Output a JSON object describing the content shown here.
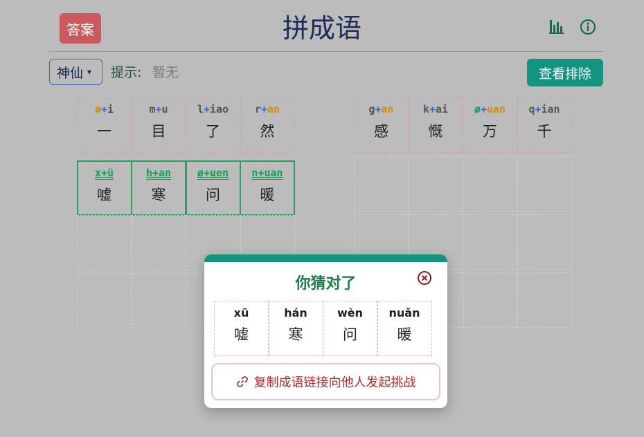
{
  "header": {
    "answer_label": "答案",
    "title": "拼成语"
  },
  "toolbar": {
    "mode": "神仙",
    "hint_label": "提示:",
    "hint_value": "暂无",
    "exclude_label": "查看排除"
  },
  "left_grid": {
    "rows": [
      {
        "state": "guess",
        "cells": [
          {
            "initial": "ø",
            "initial_color": "orange",
            "final": "i",
            "final_color": "plain",
            "char": "一"
          },
          {
            "initial": "m",
            "initial_color": "plain",
            "final": "u",
            "final_color": "plain",
            "char": "目"
          },
          {
            "initial": "l",
            "initial_color": "plain",
            "final": "iao",
            "final_color": "plain",
            "char": "了"
          },
          {
            "initial": "r",
            "initial_color": "plain",
            "final": "an",
            "final_color": "orange",
            "char": "然"
          }
        ]
      },
      {
        "state": "correct",
        "cells": [
          {
            "initial": "x",
            "initial_color": "green",
            "final": "ü",
            "final_color": "green",
            "char": "嘘"
          },
          {
            "initial": "h",
            "initial_color": "green",
            "final": "an",
            "final_color": "green",
            "char": "寒"
          },
          {
            "initial": "ø",
            "initial_color": "green",
            "final": "uen",
            "final_color": "green",
            "char": "问"
          },
          {
            "initial": "n",
            "initial_color": "green",
            "final": "uan",
            "final_color": "green",
            "char": "暖"
          }
        ]
      }
    ],
    "empty_rows": 2
  },
  "right_grid": {
    "rows": [
      {
        "state": "guess",
        "cells": [
          {
            "initial": "g",
            "initial_color": "plain",
            "final": "an",
            "final_color": "orange",
            "char": "感"
          },
          {
            "initial": "k",
            "initial_color": "plain",
            "final": "ai",
            "final_color": "plain",
            "char": "慨"
          },
          {
            "initial": "ø",
            "initial_color": "green",
            "final": "uan",
            "final_color": "orange",
            "char": "万"
          },
          {
            "initial": "q",
            "initial_color": "plain",
            "final": "ian",
            "final_color": "plain",
            "char": "千"
          }
        ]
      }
    ],
    "empty_rows": 3
  },
  "modal": {
    "title": "你猜对了",
    "cells": [
      {
        "pinyin": "xū",
        "char": "嘘"
      },
      {
        "pinyin": "hán",
        "char": "寒"
      },
      {
        "pinyin": "wèn",
        "char": "问"
      },
      {
        "pinyin": "nuǎn",
        "char": "暖"
      }
    ],
    "share_label": "复制成语链接向他人发起挑战"
  },
  "colors": {
    "accent": "#149480",
    "answer_button": "#c85a5e",
    "correct": "#2e9e63",
    "present": "#d48b13",
    "danger": "#b52a2a"
  },
  "icons": {
    "stats": "bar-chart-icon",
    "info": "info-icon",
    "close": "close-icon",
    "link": "link-icon"
  }
}
